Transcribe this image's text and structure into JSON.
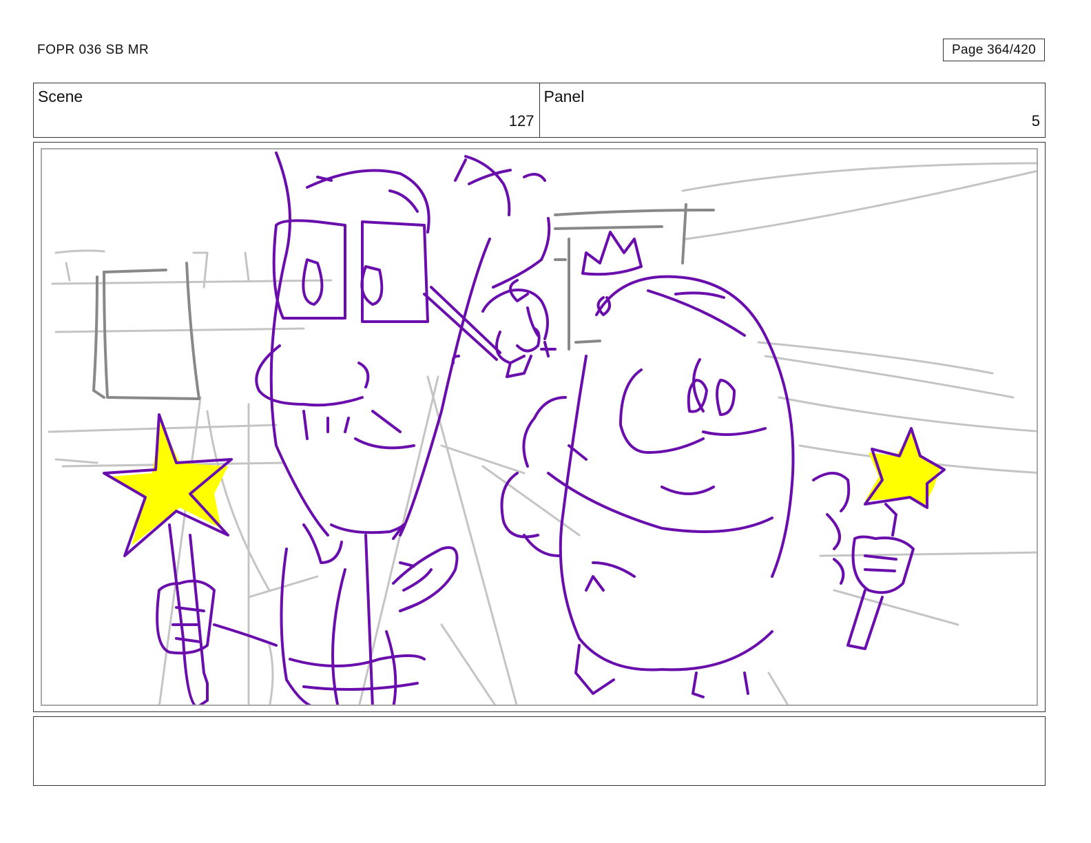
{
  "header": {
    "doc_title": "FOPR 036 SB MR",
    "page_label": "Page 364/420"
  },
  "info": {
    "scene_label": "Scene",
    "scene_value": "127",
    "panel_label": "Panel",
    "panel_value": "5"
  },
  "colors": {
    "ink_purple": "#6a0dad",
    "star_yellow": "#ffff00",
    "background_gray": "#bbbbbb",
    "background_dark_gray": "#888888"
  },
  "notes": {
    "text": ""
  }
}
